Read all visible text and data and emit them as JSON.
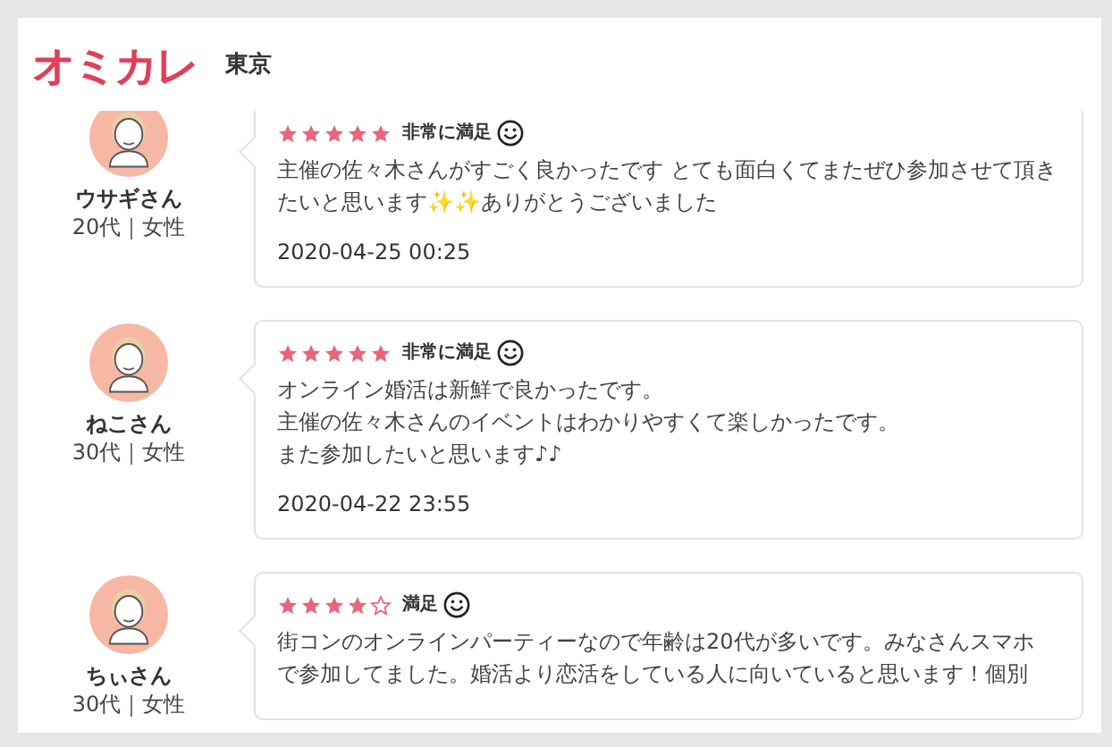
{
  "header": {
    "logo": "オミカレ",
    "area": "東京"
  },
  "reviews": [
    {
      "name": "ウサギさん",
      "profile": "20代｜女性",
      "stars": 5,
      "rating_label": "非常に満足",
      "body": [
        "主催の佐々木さんがすごく良かったです とても面白くてまたぜひ参加させて頂きたいと思います✨✨ありがとうございました"
      ],
      "date": "2020-04-25 00:25"
    },
    {
      "name": "ねこさん",
      "profile": "30代｜女性",
      "stars": 5,
      "rating_label": "非常に満足",
      "body": [
        "オンライン婚活は新鮮で良かったです。",
        "主催の佐々木さんのイベントはわかりやすくて楽しかったです。",
        "また参加したいと思います♪♪"
      ],
      "date": "2020-04-22 23:55"
    },
    {
      "name": "ちぃさん",
      "profile": "30代｜女性",
      "stars": 4,
      "rating_label": "満足",
      "body": [
        "街コンのオンラインパーティーなので年齢は20代が多いです。みなさんスマホ",
        "で参加してました。婚活より恋活をしている人に向いていると思います！個別"
      ]
    }
  ]
}
